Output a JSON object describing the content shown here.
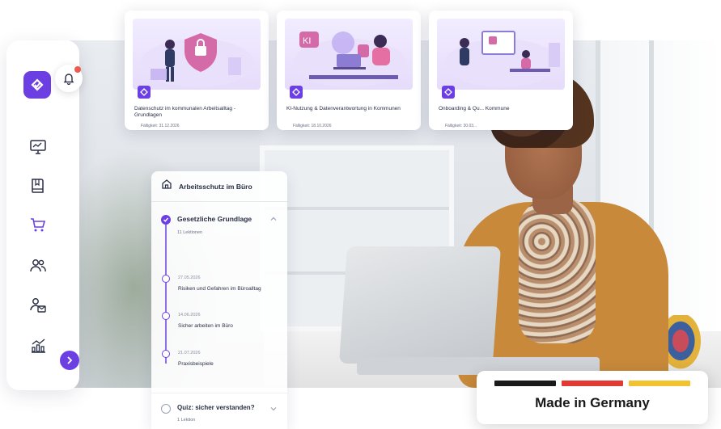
{
  "colors": {
    "accent": "#6c3fe3",
    "notification": "#ee5a4e",
    "flag_black": "#1a1a1a",
    "flag_red": "#e03a32",
    "flag_gold": "#f2c230"
  },
  "sidebar": {
    "logo_icon": "check-chevron-logo",
    "items": [
      {
        "icon": "dashboard-icon"
      },
      {
        "icon": "book-icon"
      },
      {
        "icon": "cart-icon"
      },
      {
        "icon": "users-icon"
      },
      {
        "icon": "user-mail-icon"
      },
      {
        "icon": "analytics-icon"
      }
    ],
    "bell_icon": "bell-icon",
    "expand_icon": "chevron-right-icon"
  },
  "cards": [
    {
      "title": "Datenschutz im kommunalen Arbeitsalltag - Grundlagen",
      "due": "Fälligkeit: 31.12.2026"
    },
    {
      "title": "KI-Nutzung & Datenverantwortung in Kommunen",
      "due": "Fälligkeit: 18.10.2026"
    },
    {
      "title": "Onboarding & Qu... Kommune",
      "due": "Fälligkeit: 30.03..."
    }
  ],
  "outline": {
    "title": "Arbeitsschutz im Büro",
    "section": {
      "title": "Gesetzliche Grundlage",
      "subtitle": "11 Lektionen"
    },
    "lessons": [
      {
        "date": "27.05.2026",
        "title": "Risiken und Gefahren im Büroalltag"
      },
      {
        "date": "14.06.2026",
        "title": "Sicher arbeiten im Büro"
      },
      {
        "date": "21.07.2026",
        "title": "Praxisbeispiele"
      }
    ],
    "quiz": {
      "title": "Quiz: sicher verstanden?",
      "subtitle": "1 Lektion"
    }
  },
  "badge": {
    "text": "Made in Germany"
  }
}
